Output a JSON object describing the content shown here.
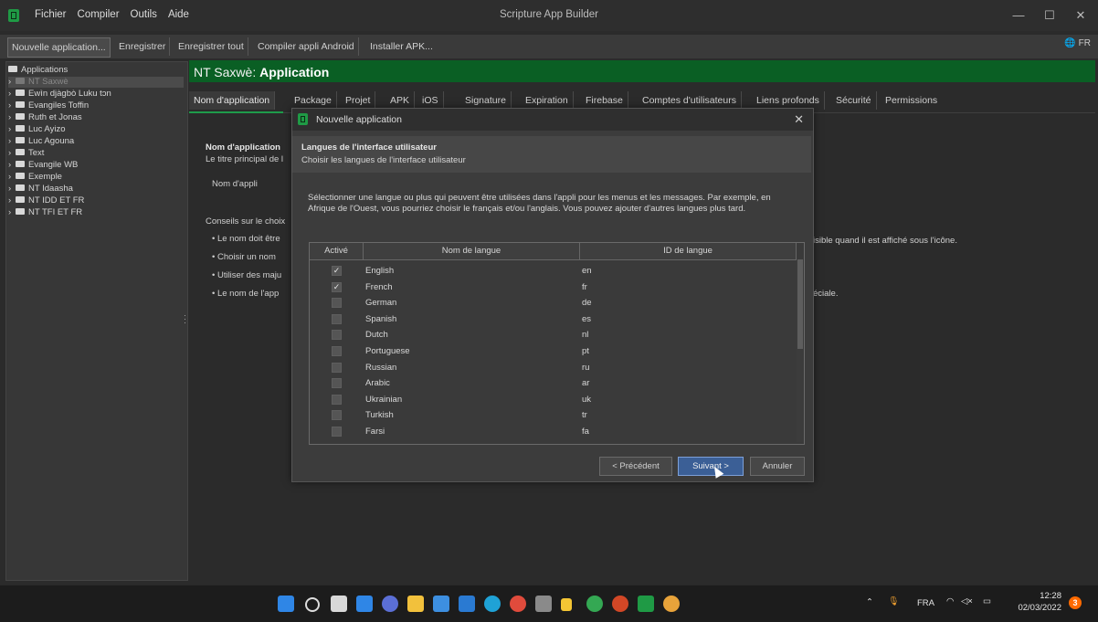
{
  "window": {
    "title": "Scripture App Builder"
  },
  "menu": [
    "Fichier",
    "Compiler",
    "Outils",
    "Aide"
  ],
  "toolbar": {
    "buttons": [
      "Nouvelle application...",
      "Enregistrer",
      "Enregistrer tout",
      "Compiler appli Android",
      "Installer APK..."
    ],
    "lang": "FR"
  },
  "tree": {
    "root": "Applications",
    "items": [
      "NT Saxwè",
      "Ewìn djàgbò Luku tɔn",
      "Evangiles Toffin",
      "Ruth et Jonas",
      "Luc Ayizo",
      "Luc Agouna",
      "Text",
      "Evangile WB",
      "Exemple",
      "NT Idaasha",
      "NT IDD ET FR",
      "NT TFI ET FR"
    ]
  },
  "header": {
    "prefix": "NT Saxwè: ",
    "title": "Application"
  },
  "tabs": [
    "Nom d'application",
    "Package",
    "Projet",
    "APK",
    "iOS",
    "Signature",
    "Expiration",
    "Firebase",
    "Comptes d'utilisateurs",
    "Liens profonds",
    "Sécurité",
    "Permissions"
  ],
  "content": {
    "section_title": "Nom d'application",
    "section_desc": "Le titre principal de l",
    "field_label": "Nom d'appli",
    "tips_title": "Conseils sur le choix",
    "tips": [
      "•  Le nom doit être",
      "•  Choisir un nom",
      "•  Utiliser des maju",
      "•  Le nom de l'app"
    ],
    "right_text_1": "isible quand il est affiché sous l'icône.",
    "right_text_2": "éciale."
  },
  "dialog": {
    "title": "Nouvelle application",
    "header_title": "Langues de l'interface utilisateur",
    "header_subtitle": "Choisir les langues de l'interface utilisateur",
    "description": "Sélectionner une langue ou plus qui peuvent être utilisées dans l'appli pour les menus et les messages. Par exemple, en Afrique de l'Ouest, vous pourriez choisir le français et/ou l'anglais. Vous pouvez ajouter d'autres langues plus tard.",
    "columns": [
      "Activé",
      "Nom de langue",
      "ID de langue"
    ],
    "rows": [
      {
        "checked": "✓",
        "name": "English",
        "id": "en"
      },
      {
        "checked": "✓",
        "name": "French",
        "id": "fr"
      },
      {
        "checked": "",
        "name": "German",
        "id": "de"
      },
      {
        "checked": "",
        "name": "Spanish",
        "id": "es"
      },
      {
        "checked": "",
        "name": "Dutch",
        "id": "nl"
      },
      {
        "checked": "",
        "name": "Portuguese",
        "id": "pt"
      },
      {
        "checked": "",
        "name": "Russian",
        "id": "ru"
      },
      {
        "checked": "",
        "name": "Arabic",
        "id": "ar"
      },
      {
        "checked": "",
        "name": "Ukrainian",
        "id": "uk"
      },
      {
        "checked": "",
        "name": "Turkish",
        "id": "tr"
      },
      {
        "checked": "",
        "name": "Farsi",
        "id": "fa"
      }
    ],
    "buttons": {
      "prev": "< Précédent",
      "next": "Suivant >",
      "cancel": "Annuler"
    }
  },
  "taskbar": {
    "lang": "FRA",
    "time": "12:28",
    "date": "02/03/2022",
    "notif": "3"
  }
}
